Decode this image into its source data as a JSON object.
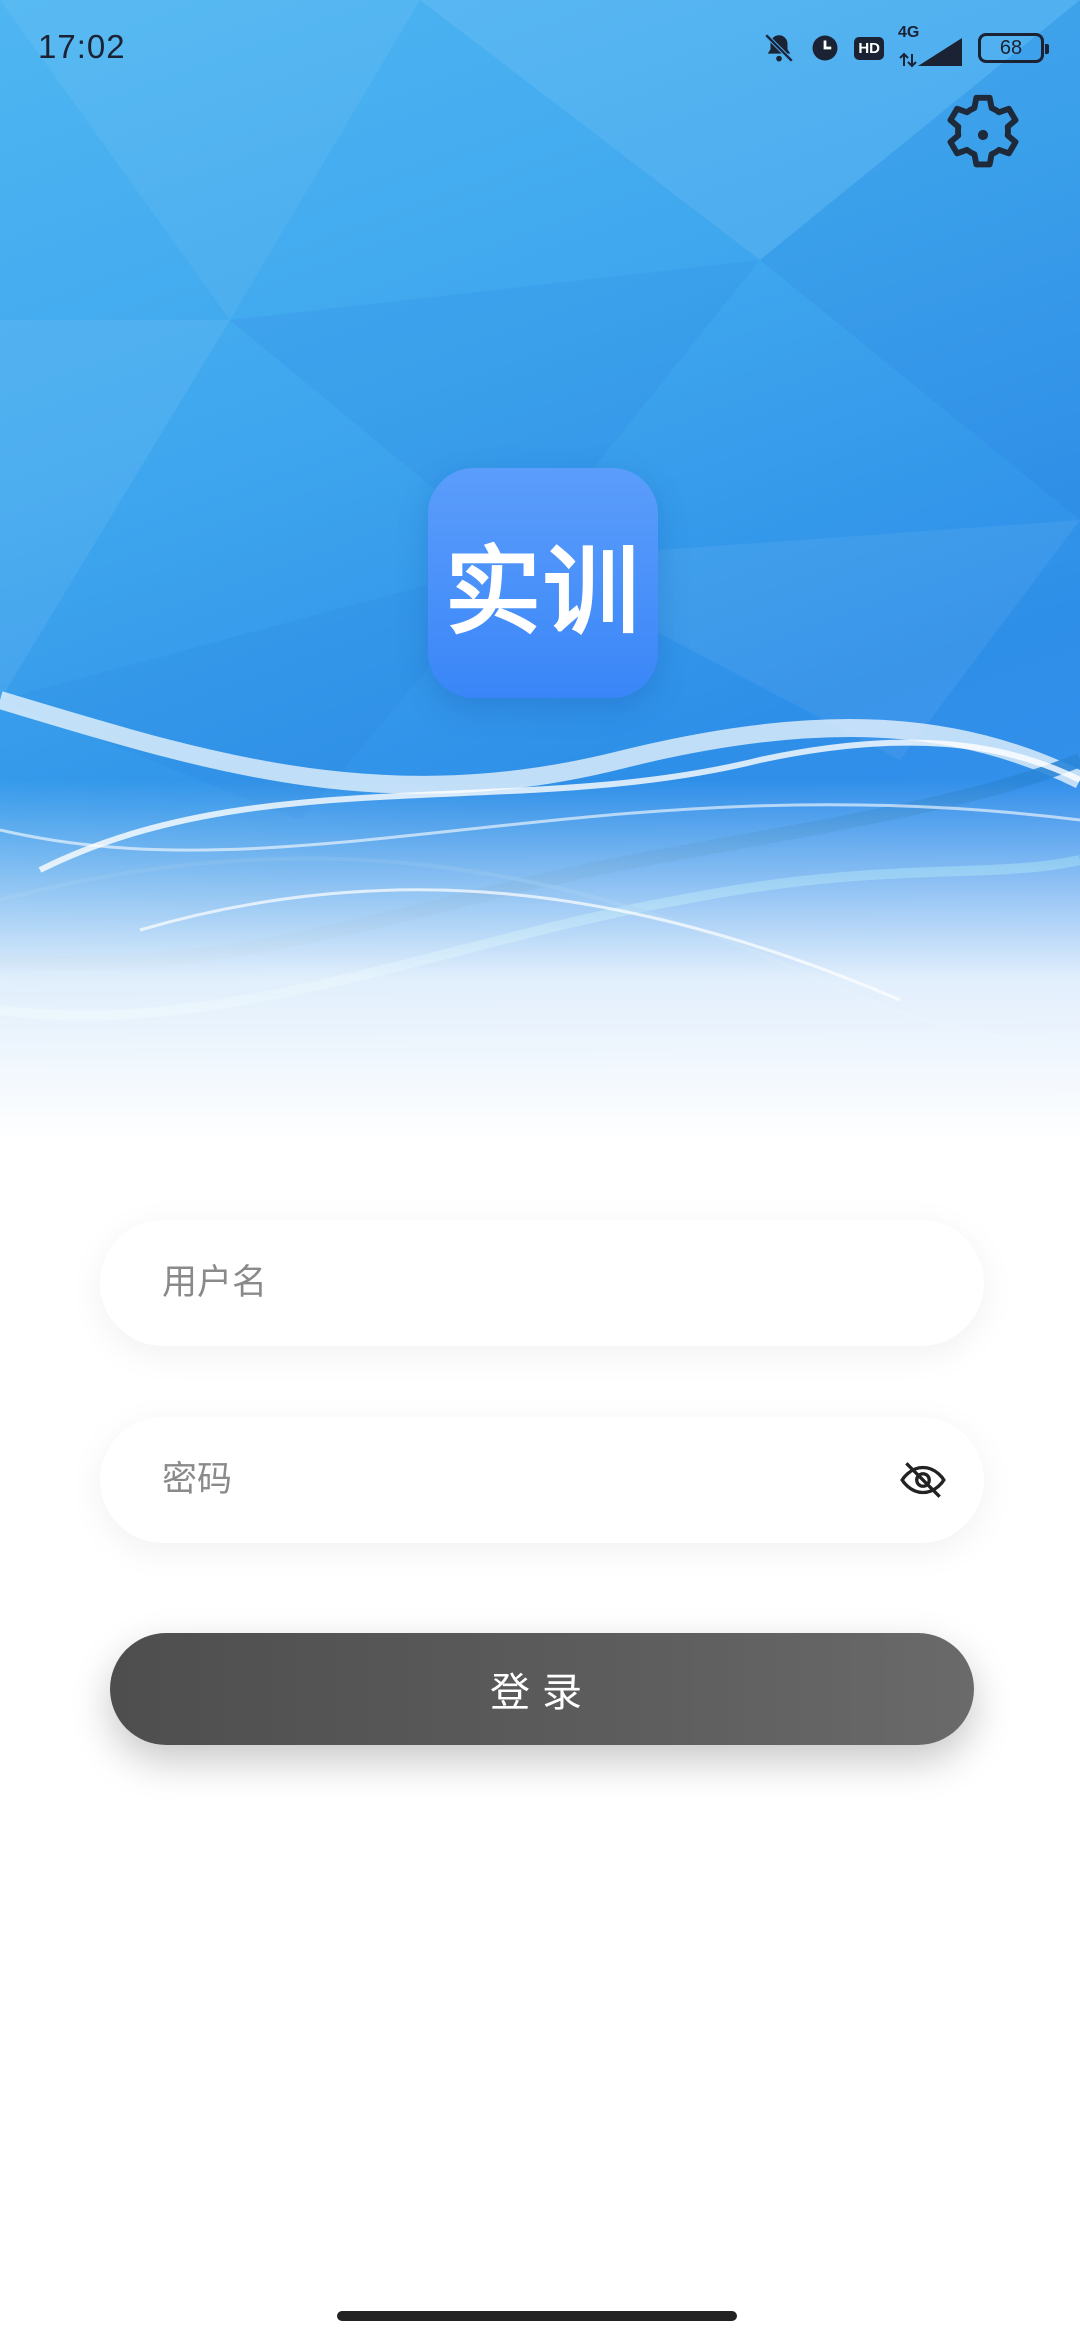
{
  "status_bar": {
    "time": "17:02",
    "network": "4G",
    "hd_badge": "HD",
    "battery": "68",
    "icons": [
      "mute-bell-icon",
      "clock-icon",
      "hd-icon",
      "signal-icon",
      "battery-icon"
    ]
  },
  "header": {
    "settings_icon": "gear-icon"
  },
  "logo": {
    "text": "实训",
    "color": "#3a86f8"
  },
  "form": {
    "username_placeholder": "用户名",
    "username_value": "",
    "password_placeholder": "密码",
    "password_value": "",
    "password_toggle_icon": "eye-off-icon",
    "login_label": "登录"
  },
  "colors": {
    "hero_blue": "#2e8fe8",
    "button_dark": "#555555"
  }
}
